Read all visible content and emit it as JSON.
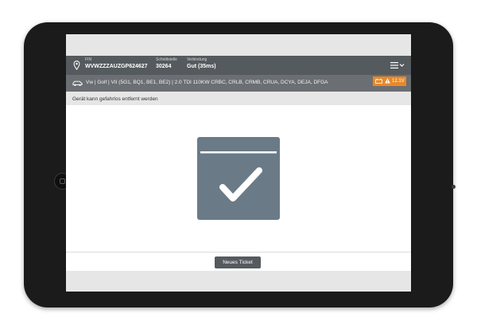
{
  "header": {
    "fin_label": "FIN",
    "fin_value": "WVWZZZAUZGP624627",
    "interface_label": "Schnittstelle",
    "interface_value": "30264",
    "connection_label": "Verbindung",
    "connection_value": "Gut (35ms)"
  },
  "vehicle": {
    "description": "Vw | Golf | VII (5G1, BQ1, BE1, BE2) | 2.0 TDI 110KW CRBC, CRLB, CRMB, CRUA, DCYA, DEJA, DFGA",
    "battery_voltage": "12.1V",
    "battery_color": "#e7892a"
  },
  "status": {
    "message": "Gerät kann gefahrlos entfernt werden"
  },
  "result": {
    "icon": "checkmark-icon",
    "color": "#6b7a87"
  },
  "footer": {
    "new_ticket_label": "Neues Ticket"
  }
}
